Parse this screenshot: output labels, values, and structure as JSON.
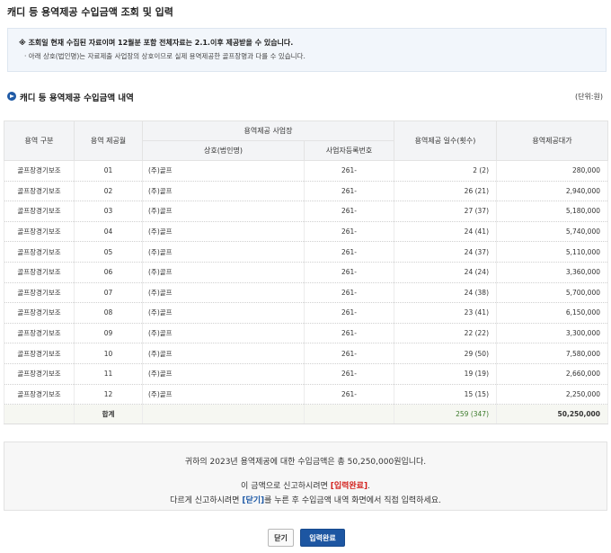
{
  "page": {
    "title": "캐디 등 용역제공 수입금액 조회 및 입력"
  },
  "notice": {
    "line1": "※ 조회일 현재 수집된 자료이며 12월분 포함 전체자료는 2.1.이후 제공받을 수 있습니다.",
    "line2": "· 아래 상호(법인명)는 자료제출 사업장의 상호이므로 실제 용역제공한 골프장명과 다를 수 있습니다."
  },
  "section": {
    "title": "캐디 등 용역제공 수입금액 내역",
    "unit": "(단위:원)"
  },
  "table": {
    "headers": {
      "type": "용역 구분",
      "month": "용역 제공월",
      "workplace": "용역제공 사업장",
      "name": "상호(법인명)",
      "bizno": "사업자등록번호",
      "days": "용역제공 일수(횟수)",
      "amount": "용역제공대가"
    },
    "rows": [
      {
        "type": "골프장경기보조",
        "month": "01",
        "name": "(주)골프",
        "bizno": "261-",
        "days": "2 (2)",
        "amount": "280,000"
      },
      {
        "type": "골프장경기보조",
        "month": "02",
        "name": "(주)골프",
        "bizno": "261-",
        "days": "26 (21)",
        "amount": "2,940,000"
      },
      {
        "type": "골프장경기보조",
        "month": "03",
        "name": "(주)골프",
        "bizno": "261-",
        "days": "27 (37)",
        "amount": "5,180,000"
      },
      {
        "type": "골프장경기보조",
        "month": "04",
        "name": "(주)골프",
        "bizno": "261-",
        "days": "24 (41)",
        "amount": "5,740,000"
      },
      {
        "type": "골프장경기보조",
        "month": "05",
        "name": "(주)골프",
        "bizno": "261-",
        "days": "24 (37)",
        "amount": "5,110,000"
      },
      {
        "type": "골프장경기보조",
        "month": "06",
        "name": "(주)골프",
        "bizno": "261-",
        "days": "24 (24)",
        "amount": "3,360,000"
      },
      {
        "type": "골프장경기보조",
        "month": "07",
        "name": "(주)골프",
        "bizno": "261-",
        "days": "24 (38)",
        "amount": "5,700,000"
      },
      {
        "type": "골프장경기보조",
        "month": "08",
        "name": "(주)골프",
        "bizno": "261-",
        "days": "23 (41)",
        "amount": "6,150,000"
      },
      {
        "type": "골프장경기보조",
        "month": "09",
        "name": "(주)골프",
        "bizno": "261-",
        "days": "22 (22)",
        "amount": "3,300,000"
      },
      {
        "type": "골프장경기보조",
        "month": "10",
        "name": "(주)골프",
        "bizno": "261-",
        "days": "29 (50)",
        "amount": "7,580,000"
      },
      {
        "type": "골프장경기보조",
        "month": "11",
        "name": "(주)골프",
        "bizno": "261-",
        "days": "19 (19)",
        "amount": "2,660,000"
      },
      {
        "type": "골프장경기보조",
        "month": "12",
        "name": "(주)골프",
        "bizno": "261-",
        "days": "15 (15)",
        "amount": "2,250,000"
      }
    ],
    "total": {
      "label": "합계",
      "days": "259 (347)",
      "amount": "50,250,000"
    }
  },
  "summary": {
    "line1": "귀하의 2023년 용역제공에 대한 수입금액은 총 50,250,000원입니다.",
    "line2_pre": "이 금액으로 신고하시려면 ",
    "line2_hl": "[입력완료]",
    "line2_post": ".",
    "line3_pre": "다르게 신고하시려면 ",
    "line3_hl": "[닫기]",
    "line3_post": "를 누른 후 수입금액 내역 화면에서 직접 입력하세요."
  },
  "buttons": {
    "close": "닫기",
    "submit": "입력완료"
  },
  "colors": {
    "accent": "#1d56a2",
    "highlight_red": "#d3221f",
    "total_green": "#3b7a2a"
  }
}
